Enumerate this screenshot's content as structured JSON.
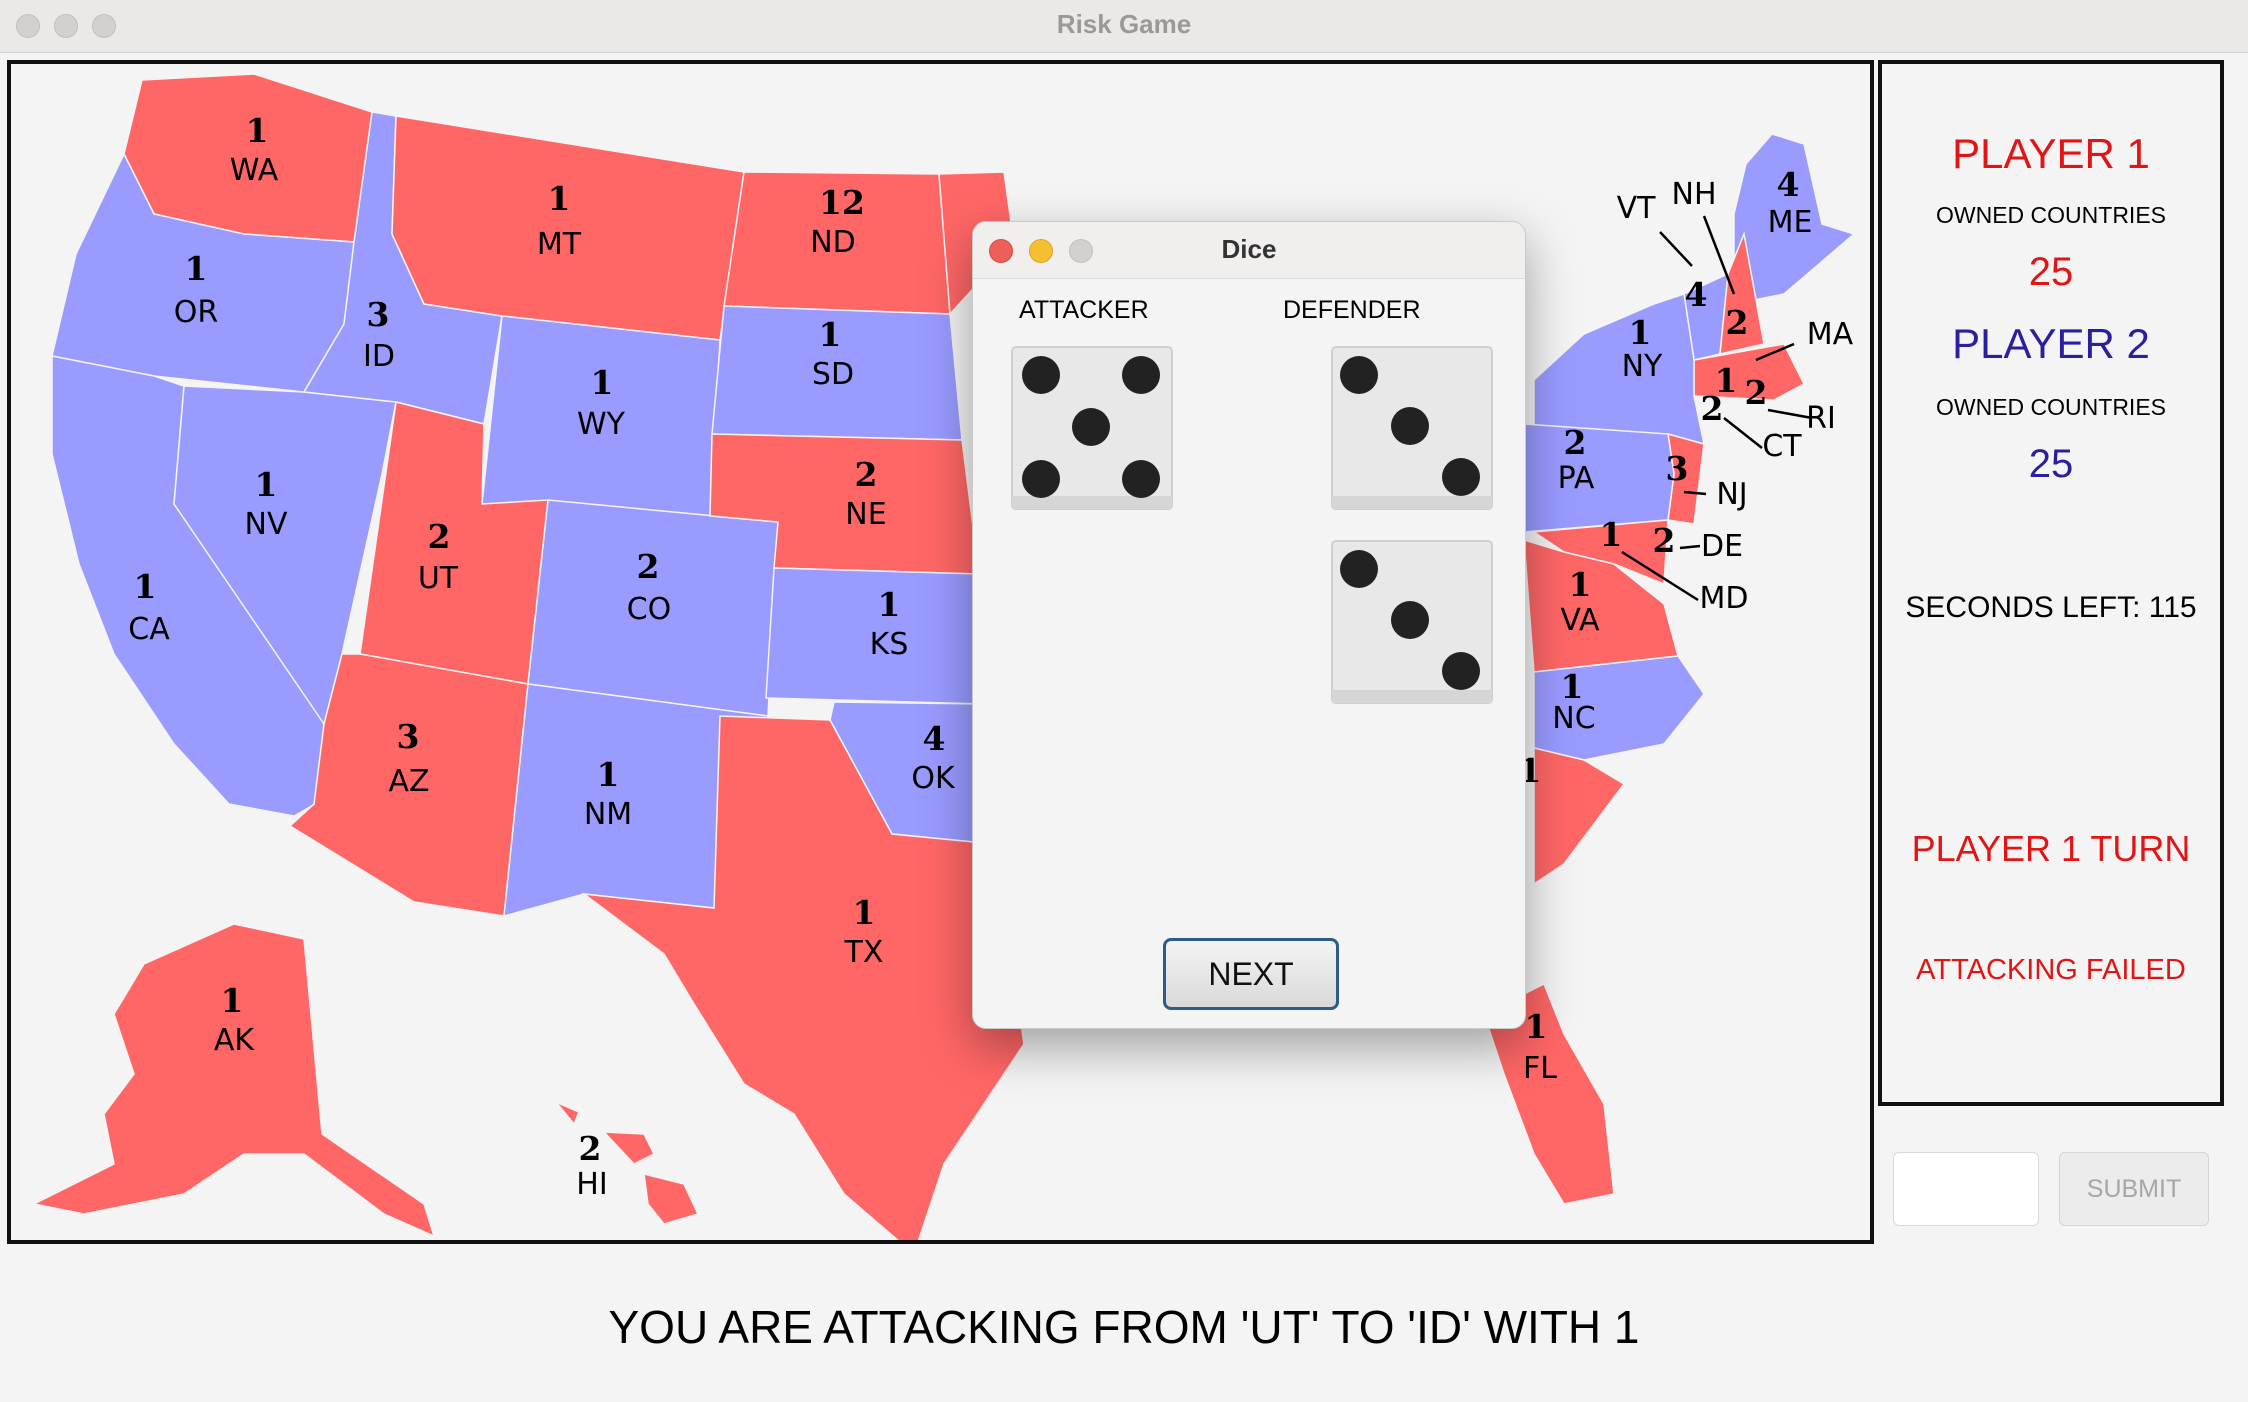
{
  "window": {
    "title": "Risk Game"
  },
  "colors": {
    "player1": "#ff6766",
    "player2": "#999bff",
    "player1_text": "#e01515",
    "player2_text": "#2a1f9c"
  },
  "map": {
    "states": [
      {
        "abbr": "WA",
        "armies": "1"
      },
      {
        "abbr": "OR",
        "armies": "1"
      },
      {
        "abbr": "CA",
        "armies": "1"
      },
      {
        "abbr": "NV",
        "armies": "1"
      },
      {
        "abbr": "ID",
        "armies": "3"
      },
      {
        "abbr": "MT",
        "armies": "1"
      },
      {
        "abbr": "WY",
        "armies": "1"
      },
      {
        "abbr": "UT",
        "armies": "2"
      },
      {
        "abbr": "AZ",
        "armies": "3"
      },
      {
        "abbr": "CO",
        "armies": "2"
      },
      {
        "abbr": "NM",
        "armies": "1"
      },
      {
        "abbr": "ND",
        "armies": "12"
      },
      {
        "abbr": "SD",
        "armies": "1"
      },
      {
        "abbr": "NE",
        "armies": "2"
      },
      {
        "abbr": "KS",
        "armies": "1"
      },
      {
        "abbr": "OK",
        "armies": "4"
      },
      {
        "abbr": "TX",
        "armies": "1"
      },
      {
        "abbr": "AK",
        "armies": "1"
      },
      {
        "abbr": "HI",
        "armies": "2"
      },
      {
        "abbr": "ME",
        "armies": "4"
      },
      {
        "abbr": "VT",
        "armies": "4"
      },
      {
        "abbr": "NH",
        "armies": "2"
      },
      {
        "abbr": "MA",
        "armies": "2"
      },
      {
        "abbr": "RI",
        "armies": "2"
      },
      {
        "abbr": "CT",
        "armies": "2"
      },
      {
        "abbr": "NY",
        "armies": "1"
      },
      {
        "abbr": "NJ",
        "armies": "3"
      },
      {
        "abbr": "PA",
        "armies": "2"
      },
      {
        "abbr": "DE",
        "armies": "2"
      },
      {
        "abbr": "MD",
        "armies": "1"
      },
      {
        "abbr": "VA",
        "armies": "1"
      },
      {
        "abbr": "NC",
        "armies": "1"
      },
      {
        "abbr": "SC",
        "armies": "1"
      },
      {
        "abbr": "FL",
        "armies": "1"
      },
      {
        "abbr": "MA_inner",
        "armies": "1"
      }
    ]
  },
  "sidebar": {
    "player1": {
      "name": "PLAYER 1",
      "owned_label": "OWNED COUNTRIES",
      "owned": "25"
    },
    "player2": {
      "name": "PLAYER 2",
      "owned_label": "OWNED COUNTRIES",
      "owned": "25"
    },
    "seconds_left": "SECONDS LEFT: 115",
    "turn": "PLAYER 1 TURN",
    "result": "ATTACKING FAILED"
  },
  "input": {
    "value": ""
  },
  "submit_label": "SUBMIT",
  "status_message": "YOU ARE ATTACKING FROM 'UT' TO 'ID' WITH 1",
  "dice_dialog": {
    "title": "Dice",
    "attacker_label": "ATTACKER",
    "defender_label": "DEFENDER",
    "attacker_dice": [
      5
    ],
    "defender_dice": [
      3,
      3
    ],
    "next_label": "NEXT"
  }
}
